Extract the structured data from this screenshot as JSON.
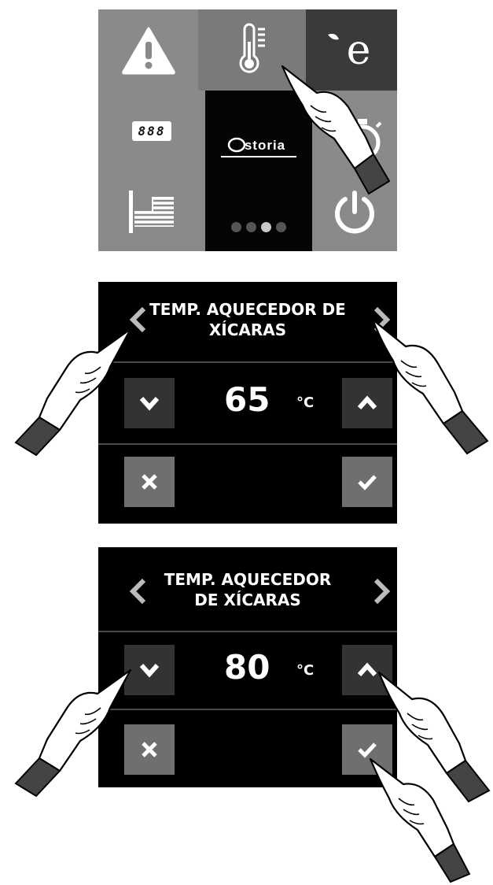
{
  "menu": {
    "eco_label": "e",
    "display_digits": "888",
    "brand_name": "storia",
    "page_dots": [
      false,
      false,
      true,
      false
    ]
  },
  "screen_1": {
    "title": "TEMP. AQUECEDOR DE XÍCARAS",
    "value": "65",
    "unit": "°C"
  },
  "screen_2": {
    "title_line1": "TEMP. AQUECEDOR",
    "title_line2": "DE XÍCARAS",
    "value": "80",
    "unit": "°C"
  },
  "colors": {
    "panel": "#000000",
    "button_dark": "#333333",
    "button_light": "#6f6f6f",
    "tile_light": "#8a8a8a",
    "tile_dark": "#3a3a3a"
  }
}
